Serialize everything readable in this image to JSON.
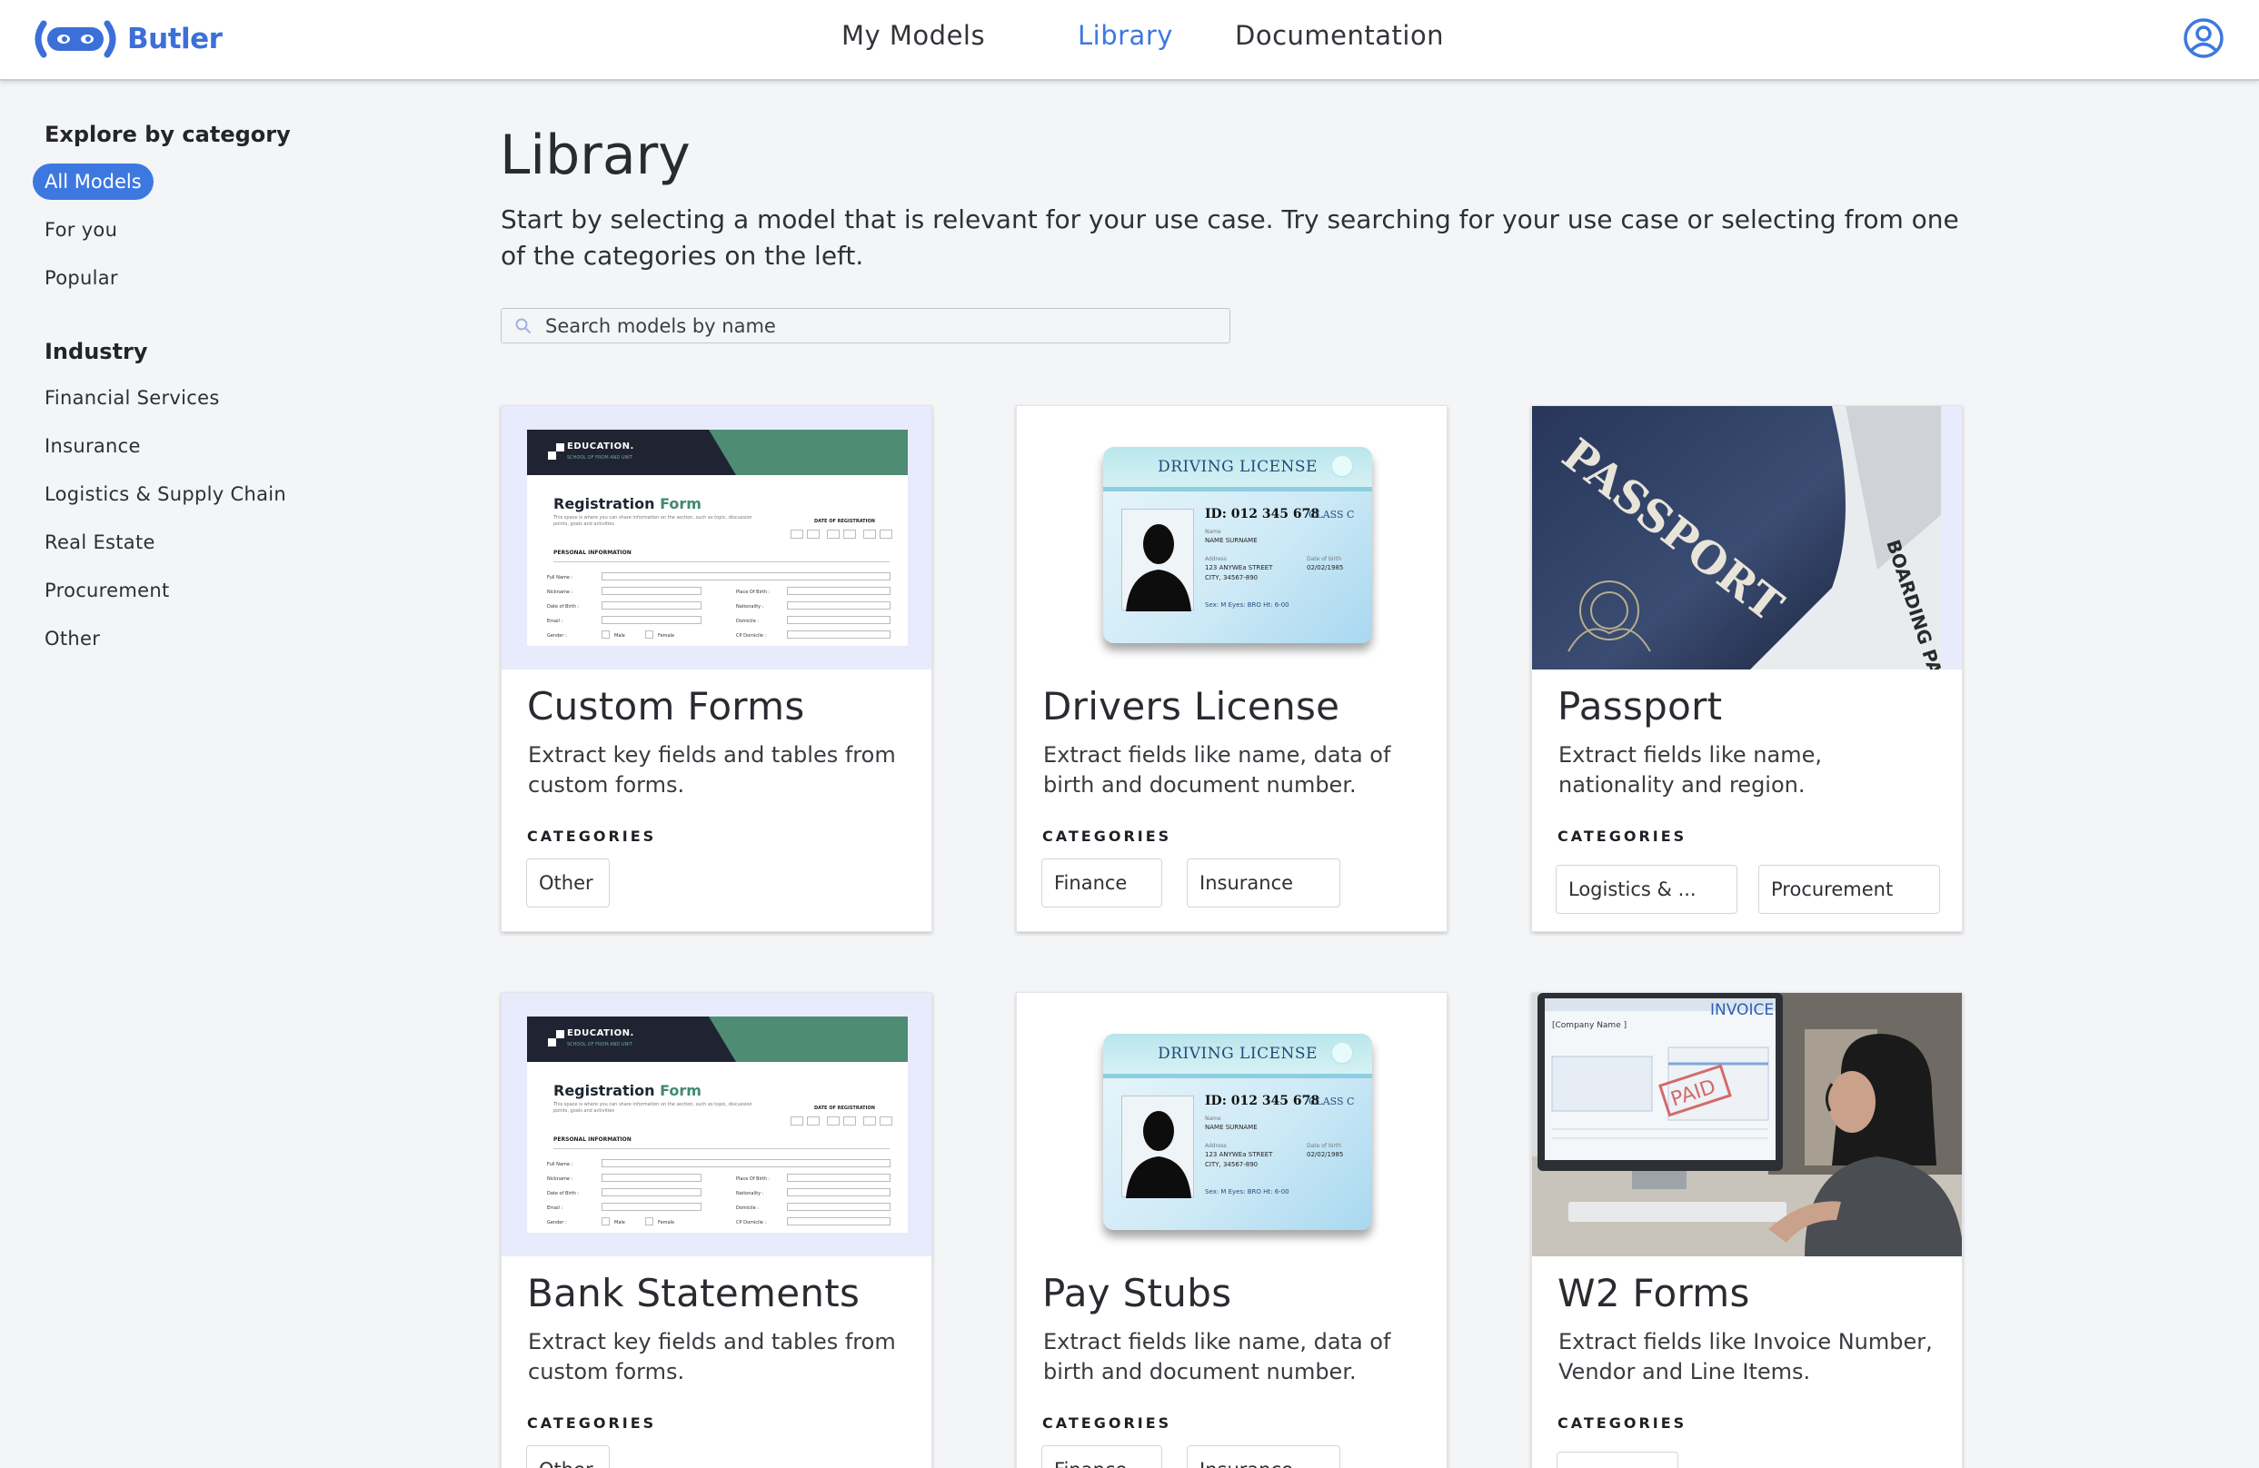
{
  "brand": {
    "name": "Butler",
    "accent": "#3d78e0"
  },
  "nav": {
    "my_models": "My Models",
    "library": "Library",
    "documentation": "Documentation",
    "active": "Library",
    "account_icon": "user-circle-icon"
  },
  "sidebar": {
    "explore_title": "Explore by category",
    "explore_items": [
      "All Models",
      "For you",
      "Popular"
    ],
    "selected": "All Models",
    "industry_title": "Industry",
    "industry_items": [
      "Financial Services",
      "Insurance",
      "Logistics & Supply Chain",
      "Real Estate",
      "Procurement",
      "Other"
    ]
  },
  "main": {
    "title": "Library",
    "intro": "Start by selecting a model that is relevant for your use case. Try searching for your use case or selecting from one of the categories on the left.",
    "search_placeholder": "Search models by name",
    "categories_label": "CATEGORIES"
  },
  "thumbnails": {
    "form": {
      "header": "EDUCATION.",
      "header_sub": "SCHOOL OF FROM AND UNIT",
      "title_a": "Registration",
      "title_b": "Form",
      "blurb": "This space is where you can share information on the section, such as topic, discussion points, goals and activities",
      "date_label": "DATE OF REGISTRATION",
      "section": "PERSONAL INFORMATION",
      "fields_left": [
        "Full Name :",
        "Nickname :",
        "Date of Birth :",
        "Email :",
        "Gender :"
      ],
      "fields_right": [
        "Place Of Birth :",
        "Nationality :",
        "Domicile :",
        "CP Domicile :"
      ],
      "male": "Male",
      "female": "Female"
    },
    "license": {
      "header": "DRIVING LICENSE",
      "id": "ID: 012 345 678",
      "class": "CLASS C",
      "name_label": "Name",
      "name": "NAME SURNAME",
      "address_label": "Address",
      "address_1": "123 ANYWEa STREET",
      "address_2": "CITY, 34567-890",
      "dob_label": "Date of birth",
      "dob": "02/02/1985",
      "extra": "Sex: M   Eyes: BRO   Ht: 6-00"
    },
    "passport": {
      "word": "PASSPORT",
      "side": "BOARDING PASS"
    },
    "invoice": {
      "word": "INVOICE",
      "stamp": "PAID",
      "company": "[Company Name ]"
    }
  },
  "cards": [
    {
      "title": "Custom Forms",
      "description": "Extract key fields and tables from custom forms.",
      "tags": [
        "Other"
      ],
      "image": "form"
    },
    {
      "title": "Drivers License",
      "description": "Extract fields like name, data of birth and document number.",
      "tags": [
        "Finance",
        "Insurance"
      ],
      "image": "license"
    },
    {
      "title": "Passport",
      "description": "Extract fields like name, nationality and region.",
      "tags": [
        "Logistics & ...",
        "Procurement"
      ],
      "image": "passport"
    },
    {
      "title": "Bank Statements",
      "description": "Extract key fields and tables from custom forms.",
      "tags": [
        "Other"
      ],
      "image": "form"
    },
    {
      "title": "Pay Stubs",
      "description": "Extract fields like name, data of birth and document number.",
      "tags": [
        "Finance",
        "Insurance"
      ],
      "image": "license"
    },
    {
      "title": "W2 Forms",
      "description": "Extract fields like Invoice Number, Vendor and Line Items.",
      "tags": [
        ""
      ],
      "image": "invoice"
    }
  ]
}
